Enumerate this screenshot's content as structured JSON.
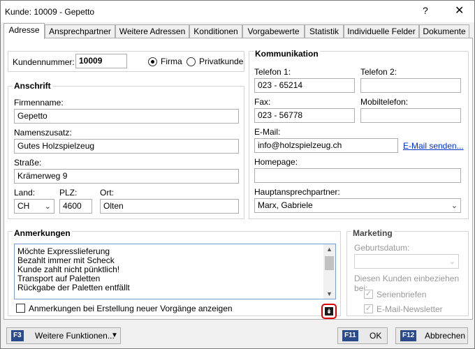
{
  "window": {
    "title": "Kunde: 10009 - Gepetto",
    "help_glyph": "?",
    "close_glyph": "✕"
  },
  "tabs": [
    {
      "label": "Adresse"
    },
    {
      "label": "Ansprechpartner"
    },
    {
      "label": "Weitere Adressen"
    },
    {
      "label": "Konditionen"
    },
    {
      "label": "Vorgabewerte"
    },
    {
      "label": "Statistik"
    },
    {
      "label": "Individuelle Felder"
    },
    {
      "label": "Dokumente"
    }
  ],
  "customer": {
    "number_label": "Kundennummer:",
    "number": "10009",
    "type_company": "Firma",
    "type_private": "Privatkunde",
    "selected_type": "Firma"
  },
  "address": {
    "title": "Anschrift",
    "company_label": "Firmenname:",
    "company": "Gepetto",
    "addition_label": "Namenszusatz:",
    "addition": "Gutes Holzspielzeug",
    "street_label": "Straße:",
    "street": "Krämerweg 9",
    "country_label": "Land:",
    "country": "CH",
    "zip_label": "PLZ:",
    "zip": "4600",
    "city_label": "Ort:",
    "city": "Olten"
  },
  "communication": {
    "title": "Kommunikation",
    "phone1_label": "Telefon 1:",
    "phone1": "023 - 65214",
    "phone2_label": "Telefon 2:",
    "phone2": "",
    "fax_label": "Fax:",
    "fax": "023 - 56778",
    "mobile_label": "Mobiltelefon:",
    "mobile": "",
    "email_label": "E-Mail:",
    "email": "info@holzspielzeug.ch",
    "email_send": "E-Mail senden...",
    "homepage_label": "Homepage:",
    "homepage": "",
    "contact_label": "Hauptansprechpartner:",
    "contact": "Marx, Gabriele"
  },
  "notes": {
    "title": "Anmerkungen",
    "lines": [
      "Möchte Expresslieferung",
      "Bezahlt immer mit Scheck",
      "Kunde zahlt nicht pünktlich!",
      "Transport auf Paletten",
      "Rückgabe der Paletten entfällt"
    ],
    "show_on_new_label": "Anmerkungen bei Erstellung neuer Vorgänge anzeigen",
    "show_on_new_checked": false
  },
  "marketing": {
    "title": "Marketing",
    "birthday_label": "Geburtsdatum:",
    "birthday": "",
    "include_label": "Diesen Kunden einbeziehen bei:",
    "serial_letters_label": "Serienbriefen",
    "serial_letters_checked": true,
    "newsletter_label": "E-Mail-Newsletter",
    "newsletter_checked": true
  },
  "footer": {
    "more_key": "F3",
    "more_label": "Weitere Funktionen...",
    "ok_key": "F11",
    "ok_label": "OK",
    "cancel_key": "F12",
    "cancel_label": "Abbrechen"
  },
  "colors": {
    "accent": "#0033cc",
    "highlight": "#e00000",
    "key_badge": "#2a4a8a"
  }
}
